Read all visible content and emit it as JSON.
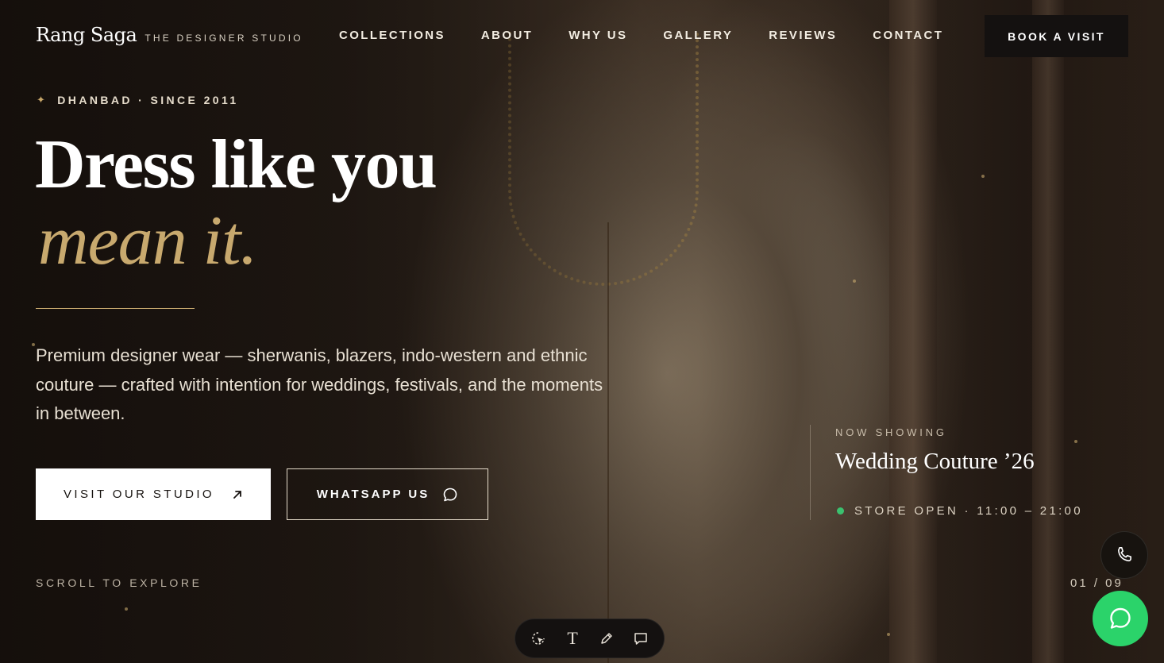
{
  "header": {
    "logo_name": "Rang Saga",
    "logo_tagline": "THE DESIGNER STUDIO",
    "nav": [
      {
        "label": "COLLECTIONS"
      },
      {
        "label": "ABOUT"
      },
      {
        "label": "WHY US"
      },
      {
        "label": "GALLERY"
      },
      {
        "label": "REVIEWS"
      },
      {
        "label": "CONTACT"
      }
    ],
    "cta_label": "BOOK A VISIT"
  },
  "hero": {
    "eyebrow_icon": "sparkle-icon",
    "eyebrow": "DHANBAD · SINCE 2011",
    "headline": "Dress like you",
    "headline_accent": "mean it.",
    "description": "Premium designer wear — sherwanis, blazers, indo-western and ethnic couture — crafted with intention for weddings, festivals, and the moments in between.",
    "primary_button": "VISIT OUR STUDIO",
    "primary_button_icon": "arrow-up-right-icon",
    "secondary_button": "WHATSAPP US",
    "secondary_button_icon": "chat-bubble-icon",
    "scroll_hint": "SCROLL TO EXPLORE",
    "slide_counter": "01 / 09"
  },
  "now_showing": {
    "label": "NOW SHOWING",
    "title": "Wedding Couture ’26",
    "status": "STORE OPEN · 11:00 – 21:00",
    "status_color": "#3bc16f"
  },
  "floating": {
    "phone_icon": "phone-icon",
    "whatsapp_icon": "whatsapp-icon",
    "whatsapp_color": "#2bd36a"
  },
  "toolbar": {
    "tools": [
      "select-icon",
      "text-icon",
      "pencil-icon",
      "comment-icon"
    ],
    "text_tool_glyph": "T"
  },
  "colors": {
    "accent_gold": "#c8a96e",
    "dark": "#141110"
  }
}
